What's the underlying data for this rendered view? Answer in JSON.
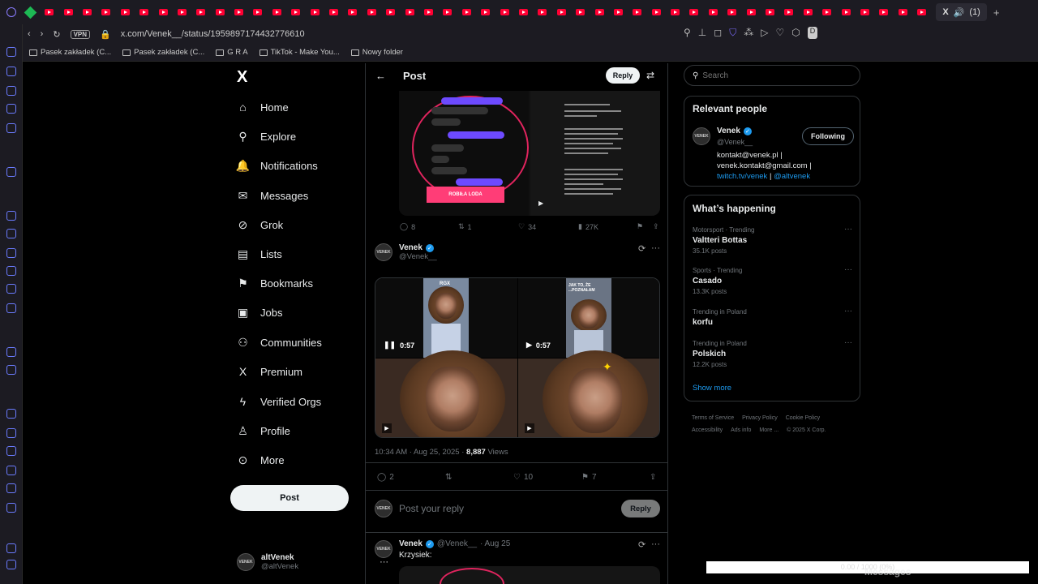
{
  "browser": {
    "active_tab_label": "(1)",
    "url": "x.com/Venek__/status/1959897174432776610",
    "vpn_label": "VPN",
    "bookmarks": [
      "Pasek zakładek (C...",
      "Pasek zakładek (C...",
      "G R A",
      "TikTok - Make You...",
      "Nowy folder"
    ]
  },
  "nav": {
    "logo": "X",
    "items": [
      {
        "label": "Home",
        "icon": "home-icon",
        "glyph": "⌂"
      },
      {
        "label": "Explore",
        "icon": "search-icon",
        "glyph": "⚲"
      },
      {
        "label": "Notifications",
        "icon": "bell-icon",
        "glyph": "🔔"
      },
      {
        "label": "Messages",
        "icon": "envelope-icon",
        "glyph": "✉"
      },
      {
        "label": "Grok",
        "icon": "grok-icon",
        "glyph": "⊘"
      },
      {
        "label": "Lists",
        "icon": "list-icon",
        "glyph": "▤"
      },
      {
        "label": "Bookmarks",
        "icon": "bookmark-icon",
        "glyph": "⚑"
      },
      {
        "label": "Jobs",
        "icon": "briefcase-icon",
        "glyph": "▣"
      },
      {
        "label": "Communities",
        "icon": "people-icon",
        "glyph": "⚇"
      },
      {
        "label": "Premium",
        "icon": "x-logo-icon",
        "glyph": "X"
      },
      {
        "label": "Verified Orgs",
        "icon": "lightning-icon",
        "glyph": "ϟ"
      },
      {
        "label": "Profile",
        "icon": "person-icon",
        "glyph": "♙"
      },
      {
        "label": "More",
        "icon": "more-circle-icon",
        "glyph": "⊙"
      }
    ],
    "post_button": "Post",
    "me": {
      "name": "altVenek",
      "handle": "@altVenek"
    }
  },
  "main": {
    "title": "Post",
    "reply_button": "Reply",
    "media1": {
      "pink_label": "ROBIŁA LODA"
    },
    "actions1": {
      "replies": "8",
      "reposts": "1",
      "likes": "34",
      "views": "27K"
    },
    "tweet": {
      "name": "Venek",
      "handle": "@Venek__",
      "avatar_text": "VENEK",
      "videos": [
        {
          "duration": "0:57",
          "caption": "RGX"
        },
        {
          "duration": "0:57",
          "caption": "JAK TO, ŻE ...POZNAŁAM"
        }
      ],
      "time": "10:34 AM · Aug 25, 2025 · ",
      "views_count": "8,887",
      "views_label": " Views",
      "replies": "2",
      "likes": "10",
      "bookmarks": "7"
    },
    "reply_placeholder": "Post your reply",
    "reply_submit": "Reply",
    "reply_tweet": {
      "name": "Venek",
      "handle": "@Venek__",
      "date": "· Aug 25",
      "text": "Krzysiek:"
    }
  },
  "right": {
    "search_placeholder": "Search",
    "relevant": {
      "title": "Relevant people",
      "name": "Venek",
      "handle": "@Venek__",
      "follow_label": "Following",
      "bio1": "kontakt@venek.pl |",
      "bio2": "venek.kontakt@gmail.com |",
      "bio3_link1": "twitch.tv/venek",
      "bio3_sep": " | ",
      "bio3_link2": "@altvenek"
    },
    "happening": {
      "title": "What’s happening",
      "trends": [
        {
          "category": "Motorsport · Trending",
          "name": "Valtteri Bottas",
          "count": "35.1K posts"
        },
        {
          "category": "Sports · Trending",
          "name": "Casado",
          "count": "13.3K posts"
        },
        {
          "category": "Trending in Poland",
          "name": "korfu",
          "count": ""
        },
        {
          "category": "Trending in Poland",
          "name": "Polskich",
          "count": "12.2K posts"
        }
      ],
      "show_more": "Show more"
    },
    "footer": {
      "l1": [
        "Terms of Service",
        "Privacy Policy",
        "Cookie Policy"
      ],
      "l2": [
        "Accessibility",
        "Ads info",
        "More ...",
        "© 2025 X Corp."
      ]
    }
  },
  "overlay": {
    "progress_text": "0.00 / 1000 (0%)",
    "messages_label": "Messages"
  },
  "colors": {
    "accent": "#1d9bf0",
    "background": "#000000",
    "text": "#e7e9ea",
    "muted": "#71767b"
  }
}
